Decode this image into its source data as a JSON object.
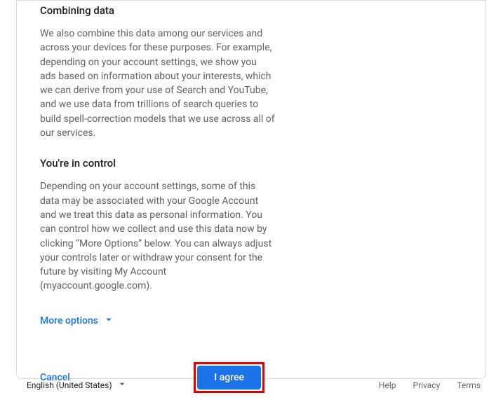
{
  "sections": {
    "combining": {
      "heading": "Combining data",
      "body": "We also combine this data among our services and across your devices for these purposes. For example, depending on your account settings, we show you ads based on information about your interests, which we can derive from your use of Search and YouTube, and we use data from trillions of search queries to build spell-correction models that we use across all of our services."
    },
    "control": {
      "heading": "You're in control",
      "body": "Depending on your account settings, some of this data may be associated with your Google Account and we treat this data as personal information. You can control how we collect and use this data now by clicking “More Options” below. You can always adjust your controls later or withdraw your consent for the future by visiting My Account (myaccount.google.com)."
    }
  },
  "actions": {
    "more_options": "More options",
    "cancel": "Cancel",
    "agree": "I agree"
  },
  "footer": {
    "language": "English (United States)",
    "links": {
      "help": "Help",
      "privacy": "Privacy",
      "terms": "Terms"
    }
  },
  "colors": {
    "primary": "#1a73e8",
    "highlight_border": "#e30000"
  }
}
